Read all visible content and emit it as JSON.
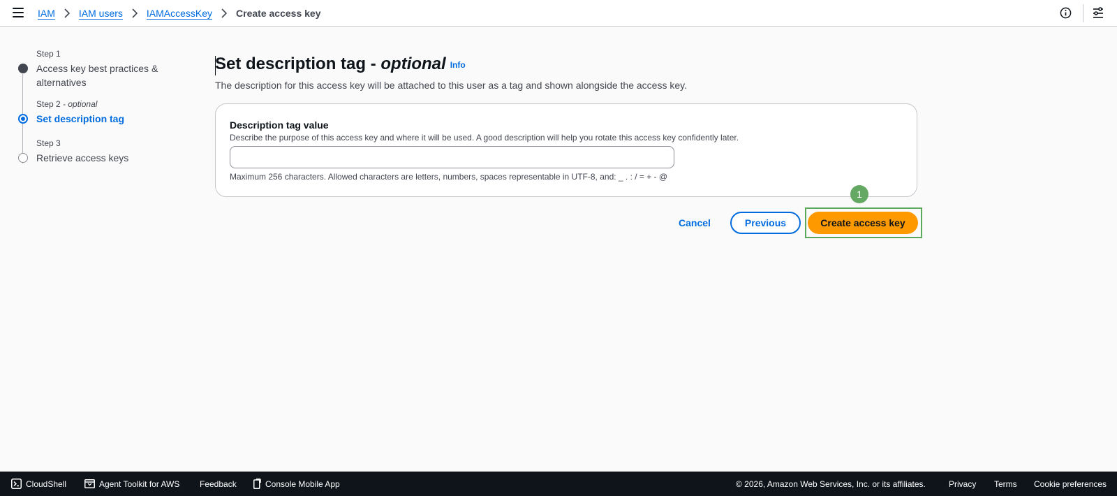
{
  "breadcrumb": {
    "items": [
      "IAM",
      "IAM users",
      "IAMAccessKey"
    ],
    "current": "Create access key"
  },
  "steps": [
    {
      "caption": "Step 1",
      "caption_suffix": "",
      "title": "Access key best practices & alternatives",
      "state": "done"
    },
    {
      "caption": "Step 2",
      "caption_suffix": " - optional",
      "title": "Set description tag",
      "state": "active"
    },
    {
      "caption": "Step 3",
      "caption_suffix": "",
      "title": "Retrieve access keys",
      "state": "todo"
    }
  ],
  "main": {
    "title": "Set description tag - ",
    "title_emphasis": "optional",
    "info_link": "Info",
    "subtitle": "The description for this access key will be attached to this user as a tag and shown alongside the access key."
  },
  "form": {
    "label": "Description tag value",
    "description": "Describe the purpose of this access key and where it will be used. A good description will help you rotate this access key confidently later.",
    "value": "",
    "constraint": "Maximum 256 characters. Allowed characters are letters, numbers, spaces representable in UTF-8, and: _ . : / = + - @"
  },
  "actions": {
    "cancel": "Cancel",
    "previous": "Previous",
    "create": "Create access key",
    "marker": "1"
  },
  "footer": {
    "cloudshell": "CloudShell",
    "agent_toolkit": "Agent Toolkit for AWS",
    "feedback": "Feedback",
    "mobile_app": "Console Mobile App",
    "copyright": "© 2026, Amazon Web Services, Inc. or its affiliates.",
    "privacy": "Privacy",
    "terms": "Terms",
    "cookie": "Cookie preferences"
  },
  "colors": {
    "link": "#006ce0",
    "primary_button": "#ff9900",
    "footer_bg": "#0f141a",
    "highlight": "#5aa95a"
  },
  "icons": [
    "menu-icon",
    "chevron-right-icon",
    "info-circle-icon",
    "settings-icon",
    "cloudshell-icon",
    "agent-toolkit-icon",
    "mobile-icon"
  ]
}
